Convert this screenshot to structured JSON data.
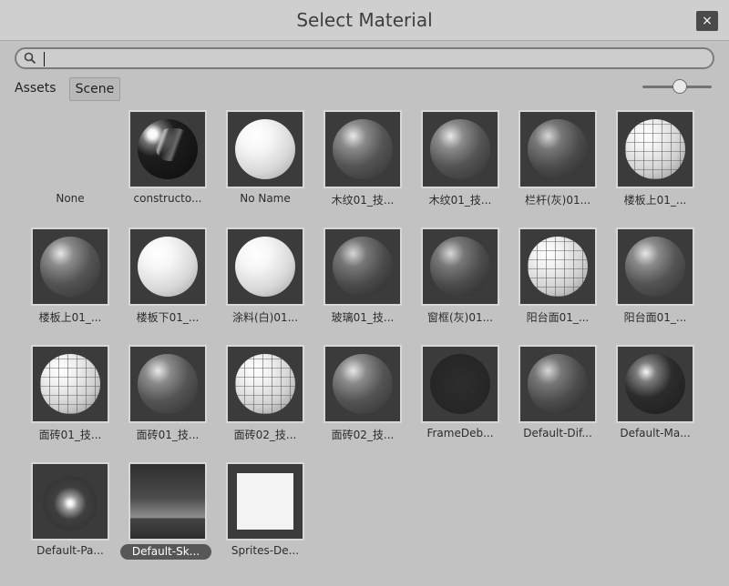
{
  "window": {
    "title": "Select Material",
    "close_label": "×"
  },
  "search": {
    "value": "",
    "placeholder": ""
  },
  "tabs": [
    {
      "label": "Assets",
      "active": false
    },
    {
      "label": "Scene",
      "active": true
    }
  ],
  "zoom": {
    "value": 0.45
  },
  "materials": [
    {
      "label": "None",
      "preview": "none"
    },
    {
      "label": "constructo...",
      "preview": "chrome"
    },
    {
      "label": "No Name",
      "preview": "white"
    },
    {
      "label": "木纹01_技...",
      "preview": "gray"
    },
    {
      "label": "木纹01_技...",
      "preview": "gray"
    },
    {
      "label": "栏杆(灰)01...",
      "preview": "mid"
    },
    {
      "label": "楼板上01_...",
      "preview": "grid"
    },
    {
      "label": "楼板上01_...",
      "preview": "gray"
    },
    {
      "label": "楼板下01_...",
      "preview": "white"
    },
    {
      "label": "涂料(白)01...",
      "preview": "white"
    },
    {
      "label": "玻璃01_技...",
      "preview": "mid"
    },
    {
      "label": "窗框(灰)01...",
      "preview": "mid"
    },
    {
      "label": "阳台面01_...",
      "preview": "grid"
    },
    {
      "label": "阳台面01_...",
      "preview": "gray"
    },
    {
      "label": "面砖01_技...",
      "preview": "grid"
    },
    {
      "label": "面砖01_技...",
      "preview": "gray"
    },
    {
      "label": "面砖02_技...",
      "preview": "grid"
    },
    {
      "label": "面砖02_技...",
      "preview": "gray"
    },
    {
      "label": "FrameDeb...",
      "preview": "black"
    },
    {
      "label": "Default-Dif...",
      "preview": "mid"
    },
    {
      "label": "Default-Ma...",
      "preview": "dark"
    },
    {
      "label": "Default-Pa...",
      "preview": "glow"
    },
    {
      "label": "Default-Sk...",
      "preview": "sky",
      "selected": true
    },
    {
      "label": "Sprites-De...",
      "preview": "square"
    }
  ]
}
